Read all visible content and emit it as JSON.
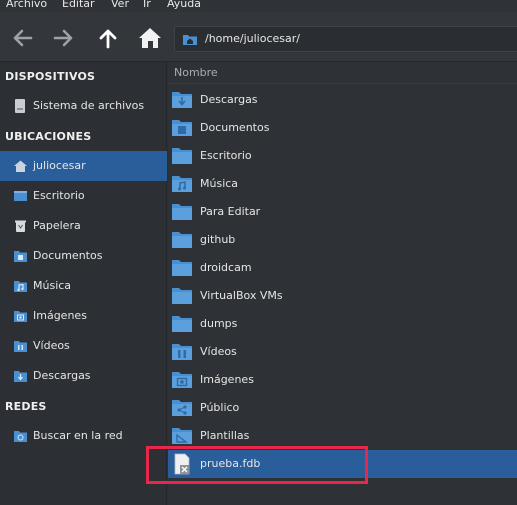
{
  "menubar": {
    "items": [
      "Archivo",
      "Editar",
      "Ver",
      "Ir",
      "Ayuda"
    ]
  },
  "toolbar": {
    "back_icon": "arrow-left-icon",
    "forward_icon": "arrow-right-icon",
    "up_icon": "arrow-up-icon",
    "home_icon": "home-icon",
    "path": "/home/juliocesar/"
  },
  "sidebar": {
    "sections": [
      {
        "title": "DISPOSITIVOS",
        "items": [
          {
            "label": "Sistema de archivos",
            "icon": "drive-icon"
          }
        ]
      },
      {
        "title": "UBICACIONES",
        "items": [
          {
            "label": "juliocesar",
            "icon": "home-icon",
            "selected": true
          },
          {
            "label": "Escritorio",
            "icon": "desktop-icon"
          },
          {
            "label": "Papelera",
            "icon": "trash-icon"
          },
          {
            "label": "Documentos",
            "icon": "folder-documents-icon"
          },
          {
            "label": "Música",
            "icon": "folder-music-icon"
          },
          {
            "label": "Imágenes",
            "icon": "folder-pictures-icon"
          },
          {
            "label": "Vídeos",
            "icon": "folder-videos-icon"
          },
          {
            "label": "Descargas",
            "icon": "folder-download-icon"
          }
        ]
      },
      {
        "title": "REDES",
        "items": [
          {
            "label": "Buscar en la red",
            "icon": "network-icon"
          }
        ]
      }
    ]
  },
  "list": {
    "column_header": "Nombre",
    "rows": [
      {
        "label": "Descargas",
        "icon": "folder-download-icon"
      },
      {
        "label": "Documentos",
        "icon": "folder-documents-icon"
      },
      {
        "label": "Escritorio",
        "icon": "folder-desktop-icon"
      },
      {
        "label": "Música",
        "icon": "folder-music-icon"
      },
      {
        "label": "Para Editar",
        "icon": "folder-icon"
      },
      {
        "label": "github",
        "icon": "folder-icon"
      },
      {
        "label": "droidcam",
        "icon": "folder-icon"
      },
      {
        "label": "VirtualBox VMs",
        "icon": "folder-icon"
      },
      {
        "label": "dumps",
        "icon": "folder-icon"
      },
      {
        "label": "Vídeos",
        "icon": "folder-videos-icon"
      },
      {
        "label": "Imágenes",
        "icon": "folder-pictures-icon"
      },
      {
        "label": "Público",
        "icon": "folder-public-icon"
      },
      {
        "label": "Plantillas",
        "icon": "folder-templates-icon"
      },
      {
        "label": "prueba.fdb",
        "icon": "unknown-file-icon",
        "selected": true
      }
    ]
  },
  "colors": {
    "accent": "#2a5e9b",
    "folder": "#4a8fcf",
    "highlight": "#e8274b"
  }
}
